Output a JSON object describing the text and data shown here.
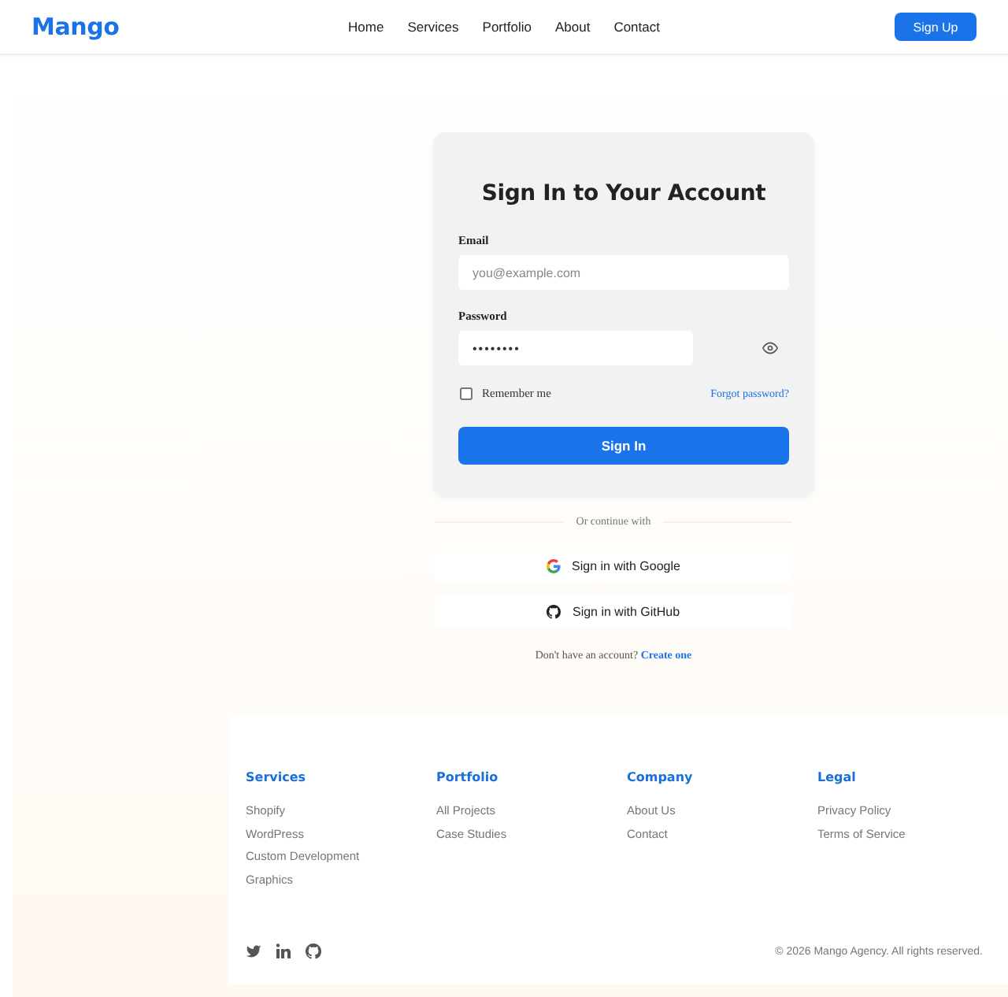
{
  "header": {
    "logo": "Mango",
    "nav": [
      "Home",
      "Services",
      "Portfolio",
      "About",
      "Contact"
    ],
    "signup_button": "Sign Up"
  },
  "signin_card": {
    "title": "Sign In to Your Account",
    "email": {
      "label": "Email",
      "placeholder": "you@example.com"
    },
    "password": {
      "label": "Password",
      "value": "••••••••"
    },
    "remember_me": {
      "label": "Remember me",
      "checked": false
    },
    "forgot_link": "Forgot password?",
    "submit_button": "Sign In"
  },
  "divider_text": "Or continue with",
  "social_buttons": [
    {
      "kind": "google",
      "label": "Sign in with Google"
    },
    {
      "kind": "github",
      "label": "Sign in with GitHub"
    }
  ],
  "signup_prompt": {
    "text": "Don't have an account?",
    "link": "Create one"
  },
  "footer": {
    "columns": [
      {
        "heading": "Services",
        "links": [
          "Shopify",
          "WordPress",
          "Custom Development",
          "Graphics"
        ]
      },
      {
        "heading": "Portfolio",
        "links": [
          "All Projects",
          "Case Studies"
        ]
      },
      {
        "heading": "Company",
        "links": [
          "About Us",
          "Contact"
        ]
      },
      {
        "heading": "Legal",
        "links": [
          "Privacy Policy",
          "Terms of Service"
        ]
      }
    ],
    "social_links": [
      {
        "kind": "twitter"
      },
      {
        "kind": "linkedin"
      },
      {
        "kind": "github"
      }
    ],
    "copyright": "© 2026 Mango Agency. All rights reserved."
  }
}
